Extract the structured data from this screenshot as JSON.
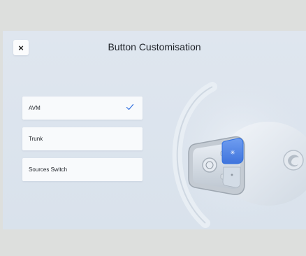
{
  "dialog": {
    "title": "Button Customisation",
    "close_label": "×"
  },
  "options": [
    {
      "label": "AVM",
      "selected": true
    },
    {
      "label": "Trunk",
      "selected": false
    },
    {
      "label": "Sources Switch",
      "selected": false
    }
  ],
  "colors": {
    "accent": "#2f6fe0",
    "highlight_button": "#4c82e8",
    "background": "#dde4ed"
  },
  "icons": {
    "close": "close-icon",
    "check": "check-icon",
    "wheel": "steering-wheel-illustration"
  }
}
